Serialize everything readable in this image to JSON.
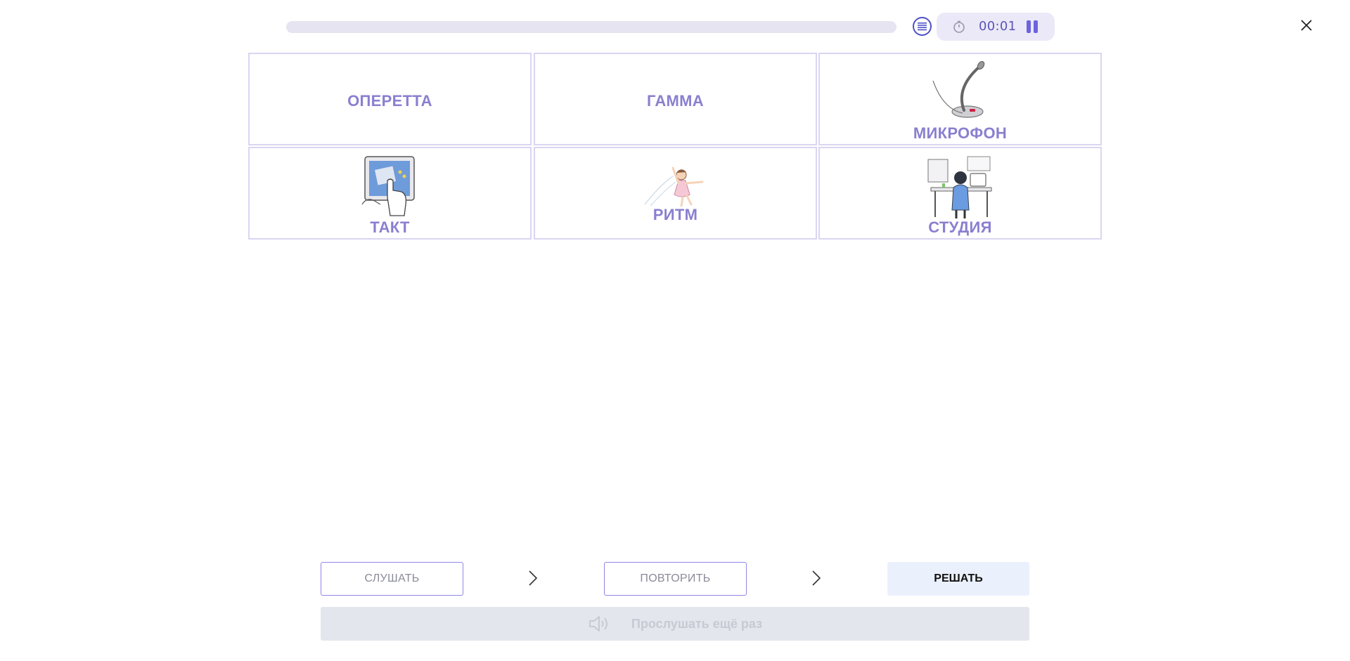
{
  "header": {
    "progress_percent": 0,
    "timer": "00:01",
    "list_icon": "list-icon",
    "timer_icon": "stopwatch-icon",
    "pause_icon": "pause-icon",
    "close_icon": "close-icon"
  },
  "cards": [
    {
      "label": "ОПЕРЕТТА",
      "image": ""
    },
    {
      "label": "ГАММА",
      "image": ""
    },
    {
      "label": "МИКРОФОН",
      "image": "microphone-icon"
    },
    {
      "label": "ТАКТ",
      "image": "touchscreen-monitor-icon"
    },
    {
      "label": "РИТМ",
      "image": "dancing-girl-icon"
    },
    {
      "label": "СТУДИЯ",
      "image": "person-at-desk-icon"
    }
  ],
  "steps": {
    "listen": "СЛУШАТЬ",
    "repeat": "ПОВТОРИТЬ",
    "solve": "РЕШАТЬ"
  },
  "replay": {
    "label": "Прослушать ещё раз",
    "icon": "speaker-icon"
  },
  "colors": {
    "accent": "#8a7fd0",
    "card_border": "#d9d6f2",
    "timer_bg": "#ebe9f7",
    "primary_bg": "#eaf0fc",
    "disabled_bg": "#e3e6ec"
  }
}
